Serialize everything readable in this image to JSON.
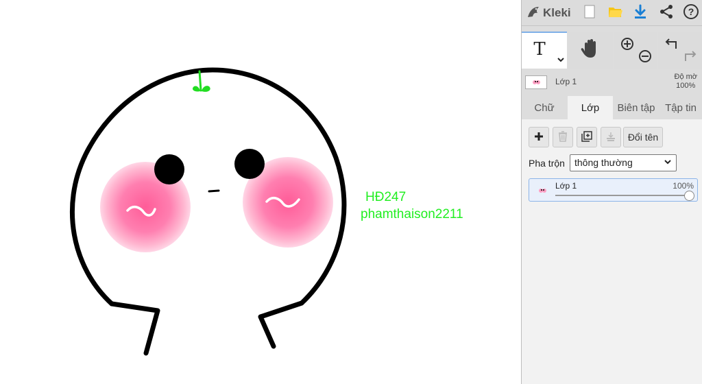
{
  "canvas": {
    "text_line1": "HĐ247",
    "text_line2": "phamthaison2211",
    "text_color": "#22ee22"
  },
  "app": {
    "name": "Kleki",
    "logo_icon": "kleki-bird-icon"
  },
  "topbar": {
    "icons": [
      "new-image-icon",
      "open-folder-icon",
      "download-icon",
      "share-icon",
      "help-icon"
    ]
  },
  "tools": {
    "active_tool": "text-tool",
    "icons": [
      "text-tool-icon",
      "hand-tool-icon",
      "zoom-in-icon",
      "zoom-out-icon",
      "undo-icon",
      "redo-icon"
    ]
  },
  "preview": {
    "layer_name": "Lớp 1",
    "opacity_label": "Độ mờ",
    "opacity_value": "100%"
  },
  "tabs": [
    {
      "label": "Chữ",
      "active": false
    },
    {
      "label": "Lớp",
      "active": true
    },
    {
      "label": "Biên tập",
      "active": false
    },
    {
      "label": "Tập tin",
      "active": false
    }
  ],
  "layers_panel": {
    "add_icon": "add-layer-icon",
    "delete_icon": "delete-layer-icon",
    "duplicate_icon": "duplicate-layer-icon",
    "merge_icon": "merge-down-icon",
    "rename_label": "Đổi tên",
    "blend_label": "Pha trộn",
    "blend_value": "thông thường",
    "layers": [
      {
        "name": "Lớp 1",
        "opacity": "100%",
        "opacity_fraction": 1.0
      }
    ]
  },
  "colors": {
    "accent_blue": "#1a7fd4",
    "folder_yellow": "#f5c518",
    "blush_pink": "#ff5c98",
    "sidebar_bg": "#dddddd",
    "panel_bg": "#f2f2f2"
  }
}
